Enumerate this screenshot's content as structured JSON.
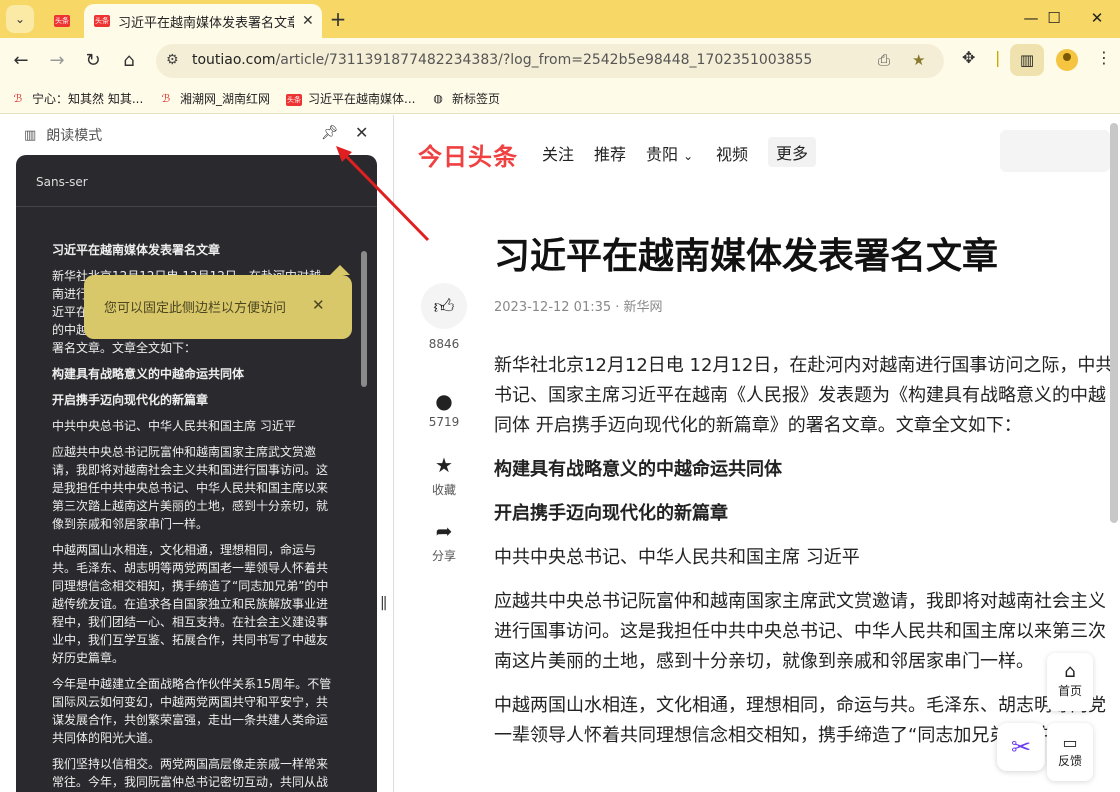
{
  "browser": {
    "tabs": [
      {
        "favicon": "头条",
        "title": ""
      },
      {
        "favicon": "头条",
        "title": "习近平在越南媒体发表署名文章"
      }
    ],
    "url_host": "toutiao.com",
    "url_path": "/article/7311391877482234383/?log_from=2542b5e98448_1702351003855"
  },
  "bookmarks": [
    {
      "icon": "baidu-icon",
      "label": "宁心：知其然 知其..."
    },
    {
      "icon": "baidu-icon",
      "label": "湘潮网_湖南红网"
    },
    {
      "icon": "toutiao-icon",
      "label": "习近平在越南媒体..."
    },
    {
      "icon": "globe-icon",
      "label": "新标签页"
    }
  ],
  "side_panel": {
    "title": "朗读模式",
    "font_select": "Sans-ser",
    "tooltip": "您可以固定此侧边栏以方便访问",
    "reader": {
      "title": "习近平在越南媒体发表署名文章",
      "paragraphs": [
        "新华社北京12月12日电 12月12日，在赴河内对越南进行国事访问之际，中共中央总书记、国家主席习近平在越南《人民报》发表题为《构建具有战略意义的中越命运共同体 开启携手迈向现代化的新篇章》的署名文章。文章全文如下：",
        "构建具有战略意义的中越命运共同体",
        "开启携手迈向现代化的新篇章",
        "中共中央总书记、中华人民共和国主席 习近平",
        "应越共中央总书记阮富仲和越南国家主席武文赏邀请，我即将对越南社会主义共和国进行国事访问。这是我担任中共中央总书记、中华人民共和国主席以来第三次踏上越南这片美丽的土地，感到十分亲切，就像到亲戚和邻居家串门一样。",
        "中越两国山水相连，文化相通，理想相同，命运与共。毛泽东、胡志明等两党两国老一辈领导人怀着共同理想信念相交相知，携手缔造了“同志加兄弟”的中越传统友谊。在追求各自国家独立和民族解放事业进程中，我们团结一心、相互支持。在社会主义建设事业中，我们互学互鉴、拓展合作，共同书写了中越友好历史篇章。",
        "今年是中越建立全面战略合作伙伴关系15周年。不管国际风云如何变幻，中越两党两国共守和平安宁，共谋发展合作，共创繁荣富强，走出一条共建人类命运共同体的阳光大道。",
        "我们坚持以信相交。两党两国高层像走亲戚一样常来常往。今年，我同阮富仲总书记密切互动，共同从战略高度和长远角度擘画新时代中越关系蓝图。推动中"
      ]
    }
  },
  "page": {
    "logo": "今日头条",
    "nav": [
      "关注",
      "推荐",
      "贵阳",
      "视频",
      "更多"
    ],
    "article_title": "习近平在越南媒体发表署名文章",
    "meta": "2023-12-12 01:35 · 新华网",
    "actions": {
      "likes": "8846",
      "comments": "5719",
      "favorite": "收藏",
      "share": "分享"
    },
    "paragraphs": [
      {
        "text": "新华社北京12月12日电 12月12日，在赴河内对越南进行国事访问之际，中共",
        "bold": false
      },
      {
        "text": "书记、国家主席习近平在越南《人民报》发表题为《构建具有战略意义的中越",
        "bold": false
      },
      {
        "text": "同体 开启携手迈向现代化的新篇章》的署名文章。文章全文如下：",
        "bold": false
      },
      {
        "text": "构建具有战略意义的中越命运共同体",
        "bold": true
      },
      {
        "text": "开启携手迈向现代化的新篇章",
        "bold": true
      },
      {
        "text": "中共中央总书记、中华人民共和国主席 习近平",
        "bold": false
      },
      {
        "text": "应越共中央总书记阮富仲和越南国家主席武文赏邀请，我即将对越南社会主义",
        "bold": false
      },
      {
        "text": "进行国事访问。这是我担任中共中央总书记、中华人民共和国主席以来第三次",
        "bold": false
      },
      {
        "text": "南这片美丽的土地，感到十分亲切，就像到亲戚和邻居家串门一样。",
        "bold": false
      },
      {
        "text": "中越两国山水相连，文化相通，理想相同，命运与共。毛泽东、胡志明等两党",
        "bold": false
      },
      {
        "text": "一辈领导人怀着共同理想信念相交相知，携手缔造了“同志加兄弟”的中越",
        "bold": false
      }
    ],
    "float": {
      "home": "首页",
      "feedback": "反馈"
    }
  }
}
